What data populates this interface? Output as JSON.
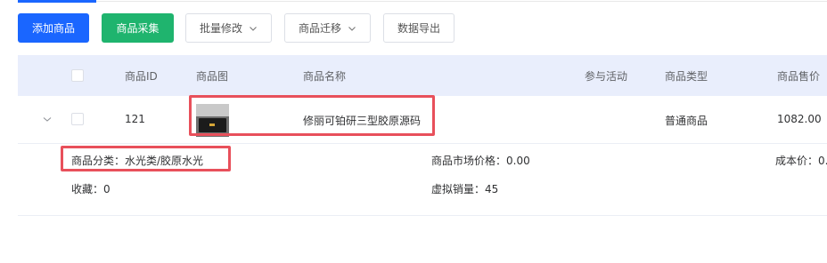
{
  "toolbar": {
    "add_label": "添加商品",
    "collect_label": "商品采集",
    "batch_edit_label": "批量修改",
    "migrate_label": "商品迁移",
    "export_label": "数据导出"
  },
  "colors": {
    "primary": "#1a66ff",
    "success": "#1fb46e",
    "header_bg": "#e9eefc",
    "highlight": "#e8505b"
  },
  "table": {
    "columns": [
      "商品ID",
      "商品图",
      "商品名称",
      "参与活动",
      "商品类型",
      "商品售价"
    ],
    "rows": [
      {
        "id": "121",
        "name": "修丽可铂研三型胶原源码",
        "activity": "",
        "type": "普通商品",
        "price": "1082.00"
      }
    ]
  },
  "details": {
    "category": "商品分类：水光类/胶原水光",
    "market_price": "商品市场价格：0.00",
    "cost": "成本价：0.",
    "favorites": "收藏：0",
    "virtual_sales": "虚拟销量：45"
  }
}
